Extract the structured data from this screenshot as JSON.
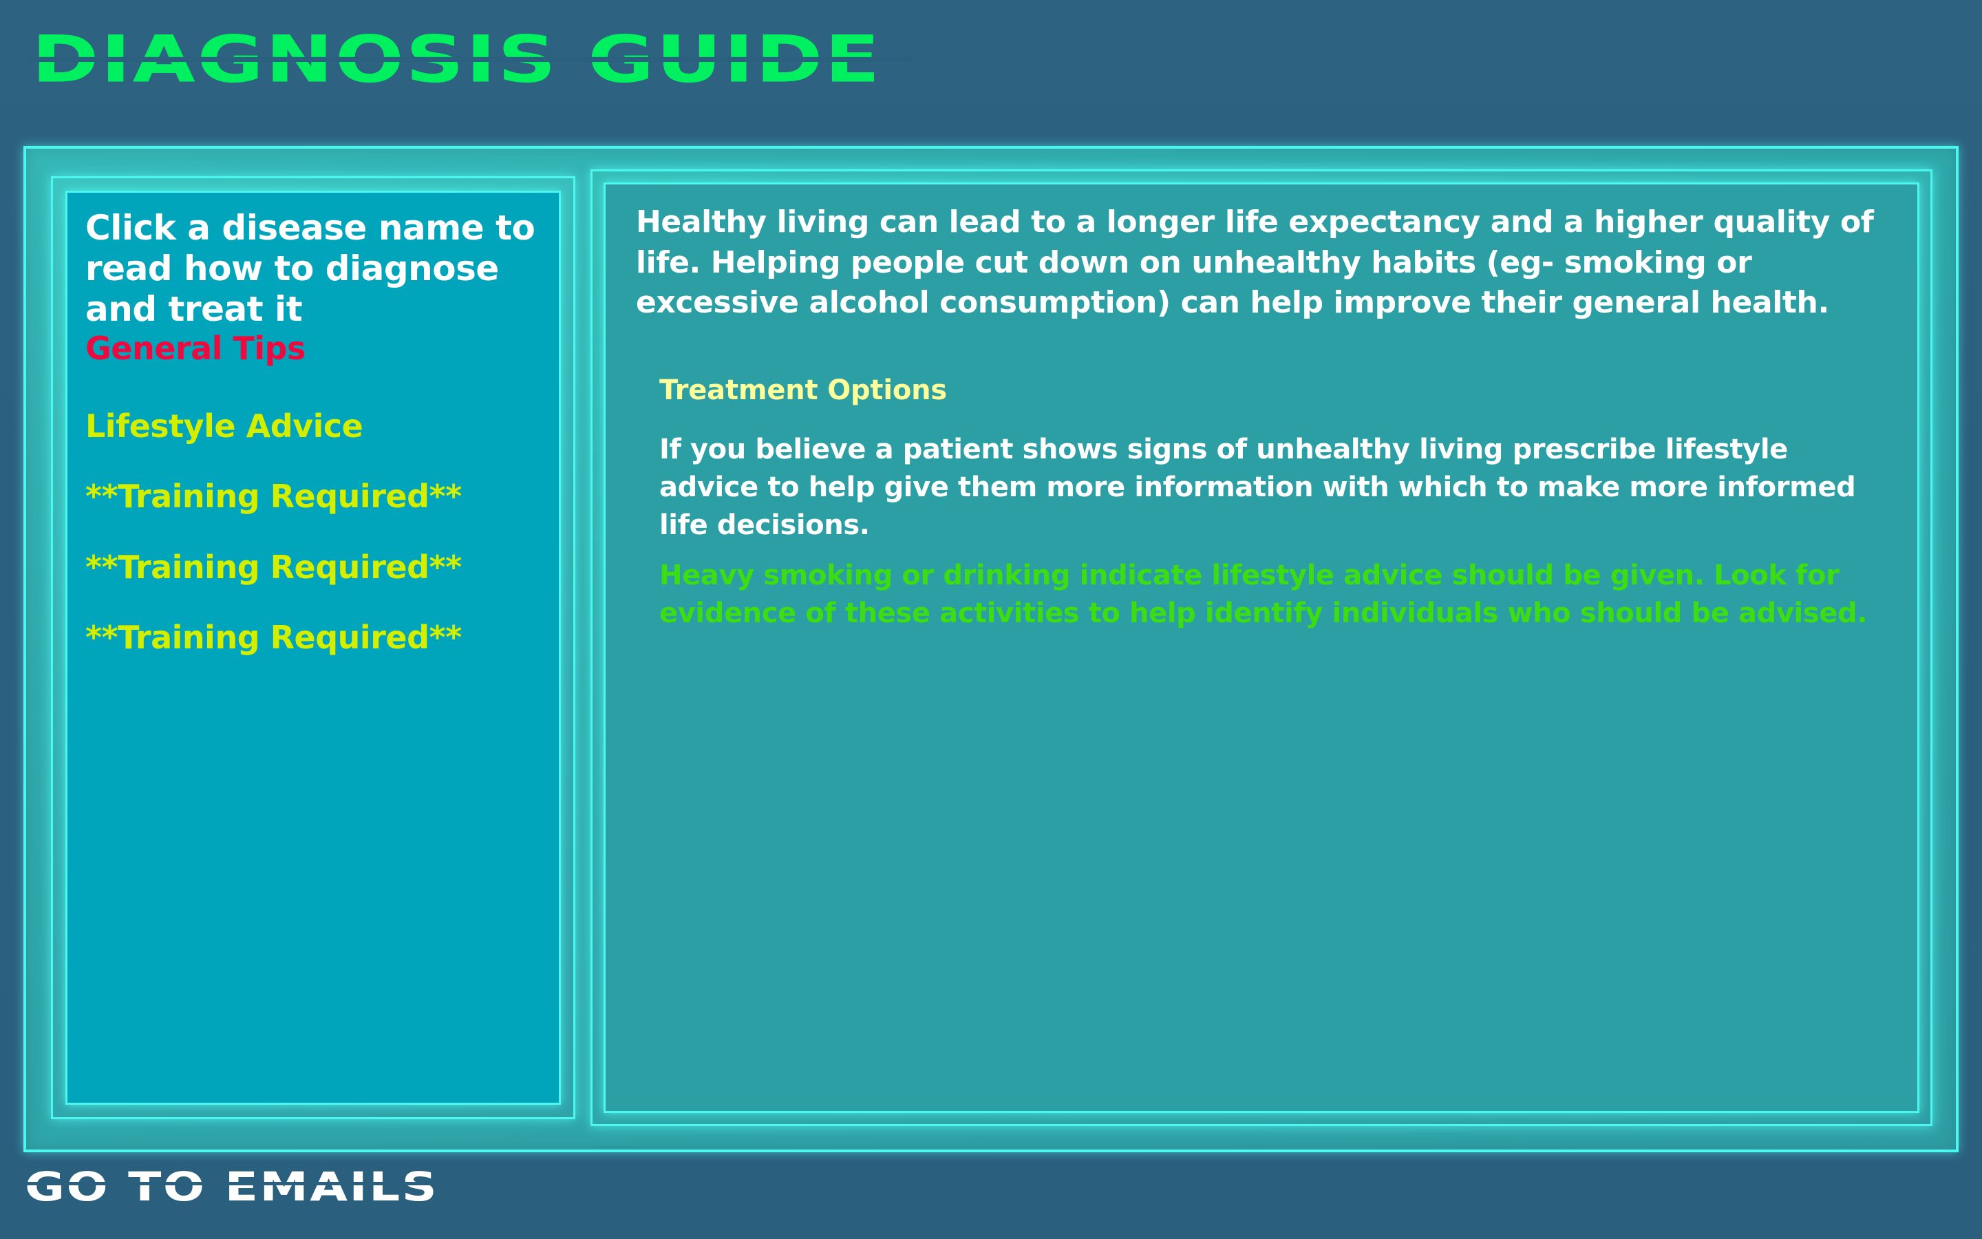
{
  "header": {
    "title": "DIAGNOSIS GUIDE",
    "title_color": "#00f060"
  },
  "theme": {
    "background": "#2b607f",
    "frame_border": "#4df7ef",
    "sidebar_fill": "#00a5bc",
    "content_fill": "#2b9fa3",
    "accent_red": "#ee0a3f",
    "accent_yellow_green": "#d4ee00",
    "accent_pale_yellow": "#ffff99",
    "accent_green": "#3cdd12"
  },
  "sidebar": {
    "instruction": "Click a disease name to read how to diagnose and treat it",
    "items": [
      {
        "label": "General Tips",
        "color": "#ee0a3f"
      },
      {
        "label": "Lifestyle Advice",
        "color": "#d4ee00"
      },
      {
        "label": "**Training Required**",
        "color": "#d4ee00"
      },
      {
        "label": "**Training Required**",
        "color": "#d4ee00"
      },
      {
        "label": "**Training Required**",
        "color": "#d4ee00"
      }
    ]
  },
  "content": {
    "intro": "Healthy living can lead to a longer life expectancy and a higher quality of life. Helping people cut down on unhealthy habits (eg- smoking or excessive alcohol consumption) can help improve their general health.",
    "section_title": "Treatment Options",
    "section_body": "If you believe a patient shows signs of unhealthy living prescribe lifestyle advice to help give them more information with which to make more informed life decisions.",
    "hint": "Heavy smoking or drinking indicate lifestyle advice should be given. Look for evidence of these activities to help identify individuals who should be advised."
  },
  "footer": {
    "goto_emails": "GO TO EMAILS"
  }
}
